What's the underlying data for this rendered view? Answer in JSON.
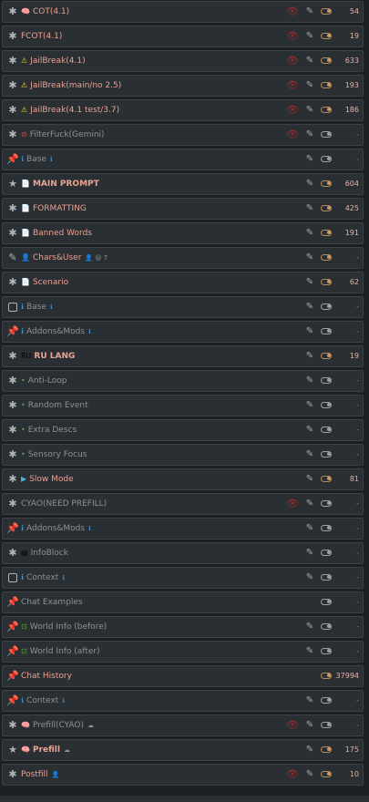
{
  "prompt_list": [
    {
      "lead": "asterisk",
      "icon": "🧠",
      "icon_class": "pink",
      "name": "COT(4.1)",
      "extra": "",
      "eye": true,
      "pencil": true,
      "on": true,
      "count": "54",
      "state": "bright"
    },
    {
      "lead": "asterisk",
      "icon": "",
      "icon_class": "",
      "name": "FCOT(4.1)",
      "extra": "",
      "eye": true,
      "pencil": true,
      "on": true,
      "count": "19",
      "state": "bright"
    },
    {
      "lead": "asterisk",
      "icon": "⚠",
      "icon_class": "yel",
      "name": "JailBreak(4.1)",
      "extra": "",
      "eye": true,
      "pencil": true,
      "on": true,
      "count": "633",
      "state": "bright"
    },
    {
      "lead": "asterisk",
      "icon": "⚠",
      "icon_class": "yel",
      "name": "JailBreak(main/no 2.5)",
      "extra": "",
      "eye": true,
      "pencil": true,
      "on": true,
      "count": "193",
      "state": "bright"
    },
    {
      "lead": "asterisk",
      "icon": "⚠",
      "icon_class": "yel",
      "name": "JailBreak(4.1 test/3.7)",
      "extra": "",
      "eye": true,
      "pencil": true,
      "on": true,
      "count": "186",
      "state": "bright"
    },
    {
      "lead": "asterisk",
      "icon": "⊘",
      "icon_class": "red",
      "name": "FilterFuck(Gemini)",
      "extra": "",
      "eye": true,
      "pencil": true,
      "on": false,
      "count": "-",
      "state": "dim"
    },
    {
      "lead": "pin",
      "icon": "ℹ",
      "icon_class": "blue",
      "name": "Base",
      "extra": "ℹ",
      "eye": false,
      "pencil": true,
      "on": false,
      "count": "-",
      "state": "dim"
    },
    {
      "lead": "star",
      "icon": "📄",
      "icon_class": "orn",
      "name": "MAIN PROMPT",
      "extra": "",
      "eye": false,
      "pencil": true,
      "on": true,
      "count": "604",
      "state": "bold"
    },
    {
      "lead": "asterisk",
      "icon": "📄",
      "icon_class": "",
      "name": "FORMATTING",
      "extra": "",
      "eye": false,
      "pencil": true,
      "on": true,
      "count": "425",
      "state": "bright"
    },
    {
      "lead": "asterisk",
      "icon": "📄",
      "icon_class": "blue",
      "name": "Banned Words",
      "extra": "",
      "eye": false,
      "pencil": true,
      "on": true,
      "count": "191",
      "state": "bright"
    },
    {
      "lead": "pencil",
      "icon": "👤",
      "icon_class": "",
      "name": "Chars&User",
      "extra": "👤 @ 7",
      "eye": false,
      "pencil": true,
      "on": true,
      "count": "-",
      "state": "bright"
    },
    {
      "lead": "asterisk",
      "icon": "📄",
      "icon_class": "",
      "name": "Scenario",
      "extra": "",
      "eye": false,
      "pencil": true,
      "on": true,
      "count": "62",
      "state": "bright"
    },
    {
      "lead": "box",
      "icon": "ℹ",
      "icon_class": "blue",
      "name": "Base",
      "extra": "ℹ",
      "eye": false,
      "pencil": true,
      "on": false,
      "count": "-",
      "state": "dim"
    },
    {
      "lead": "pin",
      "icon": "ℹ",
      "icon_class": "blue",
      "name": "Addons&Mods",
      "extra": "ℹ",
      "eye": false,
      "pencil": true,
      "on": false,
      "count": "-",
      "state": "dim"
    },
    {
      "lead": "asterisk",
      "icon": "RU",
      "icon_class": "",
      "name": "RU LANG",
      "extra": "",
      "eye": false,
      "pencil": true,
      "on": true,
      "count": "19",
      "state": "bold"
    },
    {
      "lead": "asterisk",
      "icon": "•",
      "icon_class": "grn",
      "name": "Anti-Loop",
      "extra": "",
      "eye": false,
      "pencil": true,
      "on": false,
      "count": "-",
      "state": "dim"
    },
    {
      "lead": "asterisk",
      "icon": "•",
      "icon_class": "grn",
      "name": "Random Event",
      "extra": "",
      "eye": false,
      "pencil": true,
      "on": false,
      "count": "-",
      "state": "dim"
    },
    {
      "lead": "asterisk",
      "icon": "•",
      "icon_class": "grn",
      "name": "Extra Descs",
      "extra": "",
      "eye": false,
      "pencil": true,
      "on": false,
      "count": "-",
      "state": "dim"
    },
    {
      "lead": "asterisk",
      "icon": "•",
      "icon_class": "grn",
      "name": "Sensory Focus",
      "extra": "",
      "eye": false,
      "pencil": true,
      "on": false,
      "count": "-",
      "state": "dim"
    },
    {
      "lead": "asterisk",
      "icon": "▶",
      "icon_class": "cyan",
      "name": "Slow Mode",
      "extra": "",
      "eye": false,
      "pencil": true,
      "on": true,
      "count": "81",
      "state": "bright"
    },
    {
      "lead": "asterisk",
      "icon": "",
      "icon_class": "",
      "name": "CYAO(NEED PREFILL)",
      "extra": "",
      "eye": true,
      "pencil": true,
      "on": false,
      "count": "-",
      "state": "dim"
    },
    {
      "lead": "pin",
      "icon": "ℹ",
      "icon_class": "blue",
      "name": "Addons&Mods",
      "extra": "ℹ",
      "eye": false,
      "pencil": true,
      "on": false,
      "count": "-",
      "state": "dim"
    },
    {
      "lead": "asterisk",
      "icon": "▤",
      "icon_class": "",
      "name": "InfoBlock",
      "extra": "",
      "eye": false,
      "pencil": true,
      "on": false,
      "count": "-",
      "state": "dim"
    },
    {
      "lead": "box",
      "icon": "ℹ",
      "icon_class": "blue",
      "name": "Context",
      "extra": "ℹ",
      "eye": false,
      "pencil": true,
      "on": false,
      "count": "-",
      "state": "dim"
    },
    {
      "lead": "pin",
      "icon": "",
      "icon_class": "",
      "name": "Chat Examples",
      "extra": "",
      "eye": false,
      "pencil": false,
      "on": false,
      "count": "-",
      "state": "dim"
    },
    {
      "lead": "pin",
      "icon": "⊡",
      "icon_class": "grn",
      "name": "World Info (before)",
      "extra": "",
      "eye": false,
      "pencil": true,
      "on": false,
      "count": "-",
      "state": "dim"
    },
    {
      "lead": "pin",
      "icon": "⊡",
      "icon_class": "grn",
      "name": "World Info (after)",
      "extra": "",
      "eye": false,
      "pencil": true,
      "on": false,
      "count": "-",
      "state": "dim"
    },
    {
      "lead": "pin",
      "icon": "",
      "icon_class": "",
      "name": "Chat History",
      "extra": "",
      "eye": false,
      "pencil": false,
      "on": true,
      "count": "37994",
      "state": "bright"
    },
    {
      "lead": "pin",
      "icon": "ℹ",
      "icon_class": "blue",
      "name": "Context",
      "extra": "ℹ",
      "eye": false,
      "pencil": true,
      "on": false,
      "count": "-",
      "state": "dim"
    },
    {
      "lead": "asterisk",
      "icon": "🧠",
      "icon_class": "pink",
      "name": "Prefill(CYAO)",
      "extra": "☁",
      "eye": true,
      "pencil": true,
      "on": false,
      "count": "-",
      "state": "dim"
    },
    {
      "lead": "star",
      "icon": "🧠",
      "icon_class": "pink",
      "name": "Prefill",
      "extra": "☁",
      "eye": false,
      "pencil": true,
      "on": true,
      "count": "175",
      "state": "bold"
    },
    {
      "lead": "asterisk",
      "icon": "",
      "icon_class": "",
      "name": "Postfill",
      "extra": "👤",
      "eye": true,
      "pencil": true,
      "on": true,
      "count": "10",
      "state": "bright"
    }
  ],
  "colors": {
    "active_text": "#e9a493",
    "inactive_text": "#8b9196",
    "toggle_on": "#c89a66",
    "eye_off": "#9b2a2a"
  }
}
